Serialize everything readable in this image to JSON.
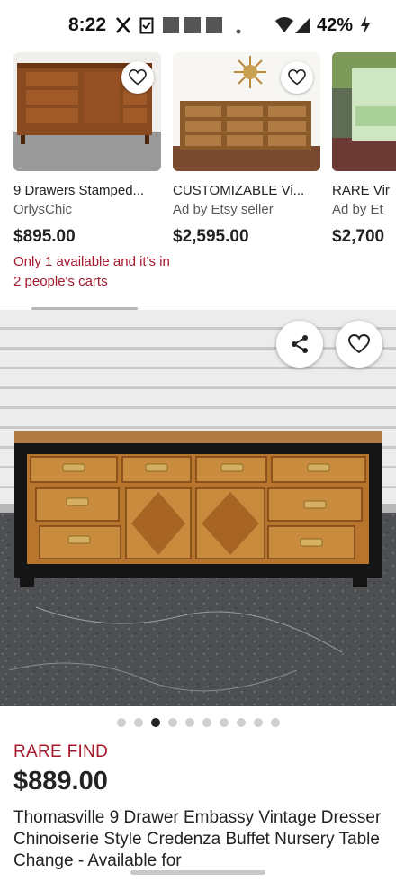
{
  "status_bar": {
    "time": "8:22",
    "battery": "42%",
    "icons": [
      "x-app-icon",
      "clipboard-icon",
      "notification-square-icon",
      "wifi-icon",
      "signal-icon",
      "charging-icon"
    ]
  },
  "recommendations": [
    {
      "title": "9 Drawers Stamped...",
      "shop": "OrlysChic",
      "price": "$895.00",
      "note": "Only 1 available and it's in 2 people's carts"
    },
    {
      "title": "CUSTOMIZABLE Vi...",
      "shop": "Ad by Etsy seller",
      "price": "$2,595.00"
    },
    {
      "title": "RARE Vir",
      "shop": "Ad by Et",
      "price": "$2,700"
    }
  ],
  "listing": {
    "badge": "RARE FIND",
    "price": "$889.00",
    "title": "Thomasville 9 Drawer Embassy Vintage Dresser Chinoiserie Style Credenza Buffet Nursery Table Change - Available for",
    "image_count": 10,
    "active_image": 3
  },
  "colors": {
    "accent_red": "#a61a2e",
    "text_dark": "#222222",
    "text_muted": "#595959"
  }
}
